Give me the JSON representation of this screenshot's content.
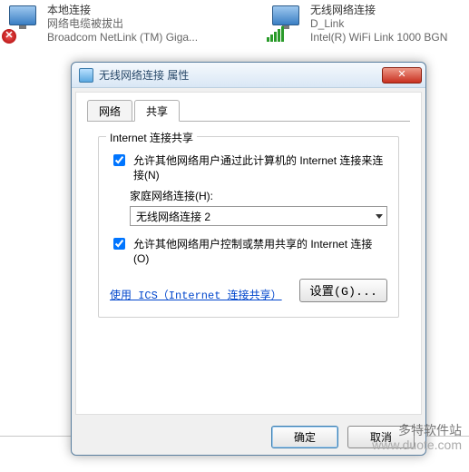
{
  "connections": {
    "wired": {
      "title": "本地连接",
      "status": "网络电缆被拔出",
      "adapter": "Broadcom NetLink (TM) Giga..."
    },
    "wireless": {
      "title": "无线网络连接",
      "ssid": "D_Link",
      "adapter": "Intel(R) WiFi Link 1000 BGN"
    }
  },
  "dialog": {
    "title": "无线网络连接 属性",
    "close_label": "✕",
    "tabs": {
      "network": "网络",
      "sharing": "共享"
    },
    "panel": {
      "legend": "Internet 连接共享",
      "check1": "允许其他网络用户通过此计算机的 Internet 连接来连接(N)",
      "home_label": "家庭网络连接(H):",
      "home_value": "无线网络连接 2",
      "check2": "允许其他网络用户控制或禁用共享的 Internet 连接(O)",
      "link": "使用 ICS（Internet 连接共享）",
      "settings_btn": "设置(G)..."
    },
    "footer": {
      "ok": "确定",
      "cancel": "取消"
    }
  },
  "watermark": {
    "line1": "多特软件站",
    "line2": "www.duote.com"
  }
}
